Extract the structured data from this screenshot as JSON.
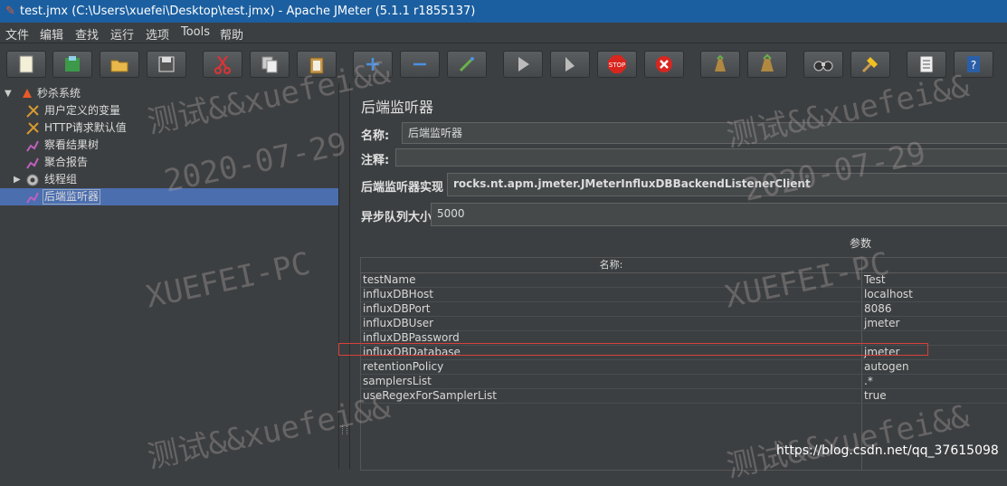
{
  "window": {
    "title": "test.jmx (C:\\Users\\xuefei\\Desktop\\test.jmx) - Apache JMeter (5.1.1 r1855137)"
  },
  "menu": [
    "文件",
    "编辑",
    "查找",
    "运行",
    "选项",
    "Tools",
    "帮助"
  ],
  "toolbar": [
    {
      "icon": "new-icon"
    },
    {
      "icon": "templates-icon"
    },
    {
      "icon": "open-icon"
    },
    {
      "icon": "save-icon"
    },
    {
      "icon": "cut-icon"
    },
    {
      "icon": "copy-icon"
    },
    {
      "icon": "paste-icon"
    },
    {
      "icon": "expand-icon"
    },
    {
      "icon": "collapse-icon"
    },
    {
      "icon": "toggle-icon"
    },
    {
      "icon": "start-icon"
    },
    {
      "icon": "start-no-pause-icon"
    },
    {
      "icon": "stop-icon"
    },
    {
      "icon": "shutdown-icon"
    },
    {
      "icon": "clear-icon"
    },
    {
      "icon": "clear-all-icon"
    },
    {
      "icon": "search-icon"
    },
    {
      "icon": "reset-search-icon"
    },
    {
      "icon": "function-helper-icon"
    },
    {
      "icon": "help-icon"
    }
  ],
  "tree": {
    "root": "秒杀系统",
    "items": [
      "用户定义的变量",
      "HTTP请求默认值",
      "察看结果树",
      "聚合报告",
      "线程组",
      "后端监听器"
    ],
    "selected": "后端监听器"
  },
  "panel": {
    "heading": "后端监听器",
    "name_label": "名称:",
    "name_value": "后端监听器",
    "comment_label": "注释:",
    "impl_label": "后端监听器实现",
    "impl_value": "rocks.nt.apm.jmeter.JMeterInfluxDBBackendListenerClient",
    "queue_label": "异步队列大小",
    "queue_value": "5000",
    "params_title": "参数",
    "col_name": "名称:",
    "params": [
      {
        "name": "testName",
        "value": "Test"
      },
      {
        "name": "influxDBHost",
        "value": "localhost"
      },
      {
        "name": "influxDBPort",
        "value": "8086"
      },
      {
        "name": "influxDBUser",
        "value": "jmeter"
      },
      {
        "name": "influxDBPassword",
        "value": ""
      },
      {
        "name": "influxDBDatabase",
        "value": "jmeter"
      },
      {
        "name": "retentionPolicy",
        "value": "autogen"
      },
      {
        "name": "samplersList",
        "value": ".*"
      },
      {
        "name": "useRegexForSamplerList",
        "value": "true"
      }
    ]
  },
  "watermarks": {
    "text1": "测试&&xuefei&&",
    "text2": "2020-07-29",
    "text3": "XUEFEI-PC",
    "text4": "测试&&xuefei&&x"
  },
  "footer_url": "https://blog.csdn.net/qq_37615098"
}
